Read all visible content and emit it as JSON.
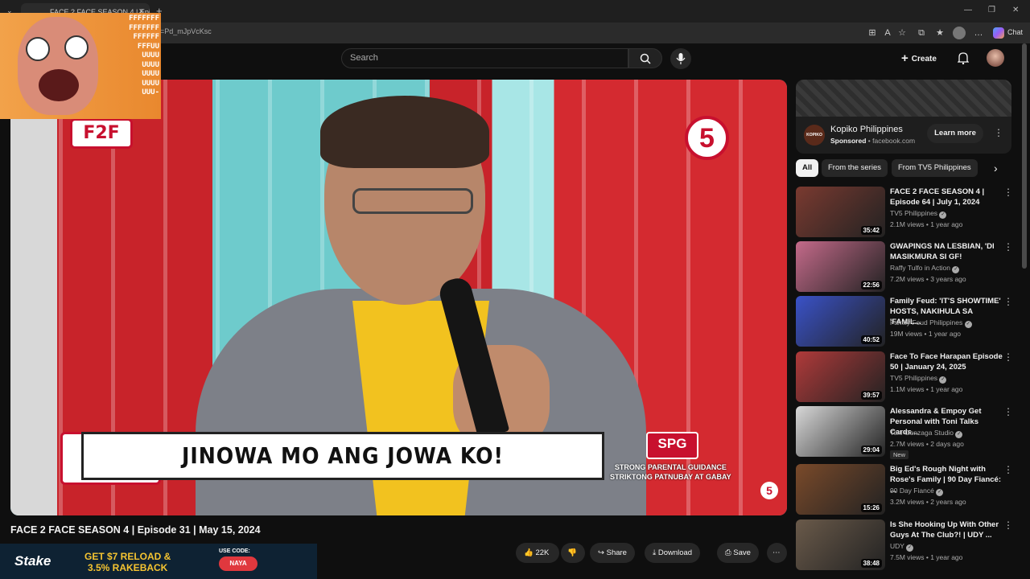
{
  "browser": {
    "tab_title": "FACE 2 FACE SEASON 4 | Epi...",
    "tab_close": "✕",
    "new_tab": "+",
    "url": "ch?v=Pd_mJpVcKsc",
    "chat_label": "Chat",
    "window_controls": [
      "—",
      "❐",
      "✕"
    ]
  },
  "header": {
    "search_placeholder": "Search",
    "create_label": "Create"
  },
  "meme": {
    "text": "FFFFFFF\nFFFFFFF\nFFFFFF\nFFFUU\nUUUU\nUUUU\nUUUU\nUUUU\nUUU-"
  },
  "video": {
    "banner_text": "JINOWA MO ANG JOWA KO!",
    "channel_logo": "5",
    "logo_top": "F2F",
    "logo_bottom": "F2F",
    "spg_label": "SPG",
    "spg_text": "STRONG PARENTAL GUIDANCE\nSTRIKTONG PATNUBAY AT GABAY"
  },
  "watch": {
    "title": "FACE 2 FACE SEASON 4 | Episode 31 | May 15, 2024",
    "likes": "22K",
    "share": "Share",
    "download": "Download",
    "save": "Save"
  },
  "stake_ad": {
    "brand": "Stake",
    "offer_line1": "GET $7 RELOAD &",
    "offer_line2": "3.5% RAKEBACK",
    "use_code": "USE CODE:",
    "code": "NAYA"
  },
  "sponsored": {
    "name": "Kopiko Philippines",
    "sponsored_label": "Sponsored",
    "domain": "facebook.com",
    "cta": "Learn more"
  },
  "chips": [
    "All",
    "From the series",
    "From TV5 Philippines"
  ],
  "recommendations": [
    {
      "title": "FACE 2 FACE SEASON 4 | Episode 64 | July 1, 2024",
      "channel": "TV5 Philippines",
      "meta": "2.1M views • 1 year ago",
      "duration": "35:42",
      "color": "#7a3a30"
    },
    {
      "title": "GWAPINGS NA LESBIAN, 'DI MASIKMURA SI GF!",
      "channel": "Raffy Tulfo in Action",
      "meta": "7.2M views • 3 years ago",
      "duration": "22:56",
      "color": "#c46a8a"
    },
    {
      "title": "Family Feud: 'IT'S SHOWTIME' HOSTS, NAKIHULA SA 'FAMIL...",
      "channel": "Family Feud Philippines",
      "meta": "19M views • 1 year ago",
      "duration": "40:52",
      "color": "#3a52c8"
    },
    {
      "title": "Face To Face Harapan Episode 50 | January 24, 2025",
      "channel": "TV5 Philippines",
      "meta": "1.1M views • 1 year ago",
      "duration": "39:57",
      "color": "#b03a3a"
    },
    {
      "title": "Alessandra & Empoy Get Personal with Toni Talks Cards...",
      "channel": "Toni Gonzaga Studio",
      "meta": "2.7M views • 2 days ago",
      "duration": "29:04",
      "color": "#d8d8d8",
      "badge": "New"
    },
    {
      "title": "Big Ed's Rough Night with Rose's Family | 90 Day Fiancé: ...",
      "channel": "90 Day Fiancé",
      "meta": "3.2M views • 2 years ago",
      "duration": "15:26",
      "color": "#7a4a2a"
    },
    {
      "title": "Is She Hooking Up With Other Guys At The Club?! | UDY ...",
      "channel": "UDY",
      "meta": "7.5M views • 1 year ago",
      "duration": "38:48",
      "color": "#6a5a4a"
    }
  ]
}
